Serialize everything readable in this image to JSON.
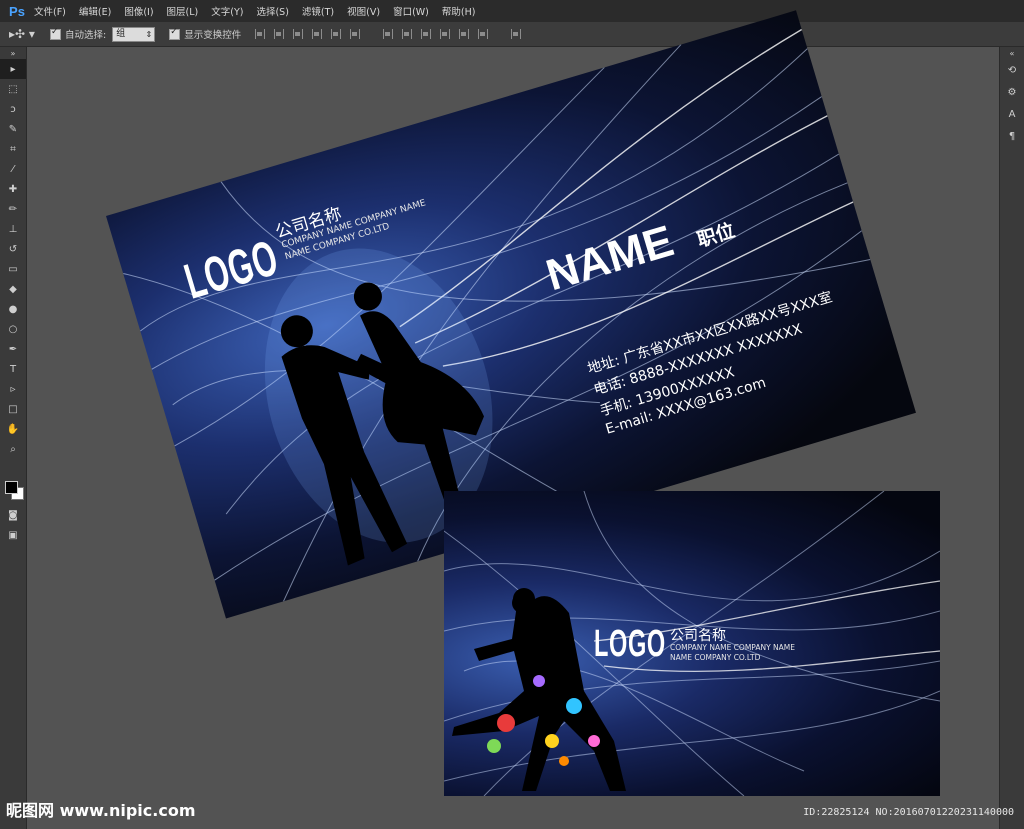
{
  "app": {
    "logo": "Ps"
  },
  "menu": [
    "文件(F)",
    "编辑(E)",
    "图像(I)",
    "图层(L)",
    "文字(Y)",
    "选择(S)",
    "滤镜(T)",
    "视图(V)",
    "窗口(W)",
    "帮助(H)"
  ],
  "options": {
    "tool_icon": "move-tool",
    "auto_select_label": "自动选择:",
    "auto_select_value": "组",
    "show_transform_label": "显示变换控件"
  },
  "card_front": {
    "logo": "LOGO",
    "company": "公司名称",
    "company_en_1": "COMPANY NAME COMPANY NAME",
    "company_en_2": "NAME COMPANY CO.LTD",
    "name": "NAME",
    "position": "职位",
    "address": "地址: 广东省XX市XX区XX路XX号XXX室",
    "phone": "电话: 8888-XXXXXXX XXXXXXX",
    "mobile": "手机: 13900XXXXXX",
    "email": "E-mail: XXXX@163.com"
  },
  "card_back": {
    "logo": "LOGO",
    "company": "公司名称",
    "company_en_1": "COMPANY NAME COMPANY NAME",
    "company_en_2": "NAME COMPANY CO.LTD"
  },
  "watermark": {
    "site": "昵图网 www.nipic.com",
    "id": "ID:22825124 NO:20160701220231140000"
  }
}
